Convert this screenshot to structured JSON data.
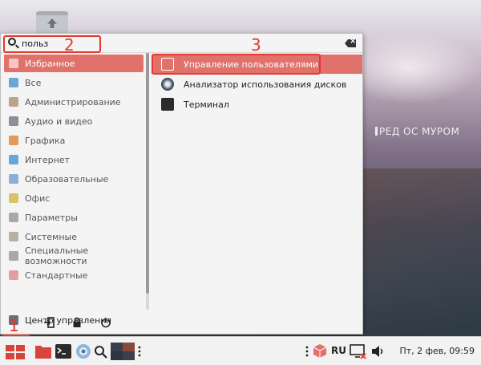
{
  "wallpaper": {
    "watermark": "РЕД ОС МУРОМ"
  },
  "search": {
    "value": "польз",
    "placeholder": ""
  },
  "categories": [
    {
      "label": "Избранное",
      "icon": "heart-icon",
      "color": "#e0726b"
    },
    {
      "label": "Все",
      "icon": "star-icon",
      "color": "#6aa6d9"
    },
    {
      "label": "Администрирование",
      "icon": "tools-icon",
      "color": "#b9a58a"
    },
    {
      "label": "Аудио и видео",
      "icon": "media-icon",
      "color": "#8a8f98"
    },
    {
      "label": "Графика",
      "icon": "brush-icon",
      "color": "#e09a5a"
    },
    {
      "label": "Интернет",
      "icon": "globe-icon",
      "color": "#6aa6d9"
    },
    {
      "label": "Образовательные",
      "icon": "flask-icon",
      "color": "#8ab0d9"
    },
    {
      "label": "Офис",
      "icon": "office-icon",
      "color": "#d8c36a"
    },
    {
      "label": "Параметры",
      "icon": "settings-icon",
      "color": "#a8a8a8"
    },
    {
      "label": "Системные",
      "icon": "system-icon",
      "color": "#b8b0a0"
    },
    {
      "label": "Специальные возможности",
      "icon": "accessibility-icon",
      "color": "#a8a8a8"
    },
    {
      "label": "Стандартные",
      "icon": "accessories-icon",
      "color": "#e0a0a0"
    }
  ],
  "control_center": {
    "label": "Центр управления",
    "icon": "control-center-icon"
  },
  "apps": [
    {
      "label": "Управление пользователями",
      "icon": "users-icon",
      "color": "#e0726b"
    },
    {
      "label": "Анализатор использования дисков",
      "icon": "disk-usage-icon",
      "color": "#3b4a5a"
    },
    {
      "label": "Терминал",
      "icon": "terminal-icon",
      "color": "#2b2b2b"
    }
  ],
  "annotations": {
    "n1": "1",
    "n2": "2",
    "n3": "3"
  },
  "taskbar": {
    "lang": "RU",
    "clock": "Пт, 2 фев, 09:59"
  },
  "colors": {
    "accent": "#e0726b",
    "annotation": "#e23a2e"
  }
}
